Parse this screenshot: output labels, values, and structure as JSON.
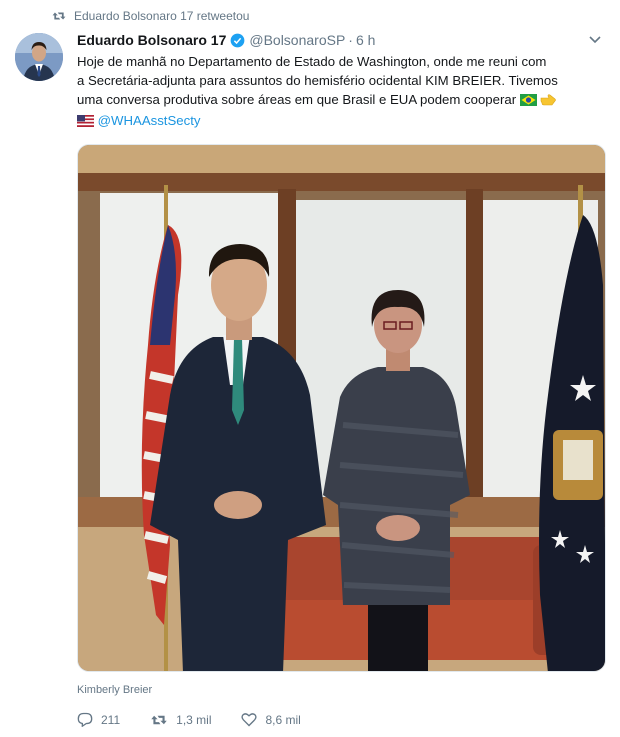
{
  "retweet_context": {
    "text": "Eduardo Bolsonaro 17 retweetou"
  },
  "tweet": {
    "display_name": "Eduardo Bolsonaro 17",
    "handle": "@BolsonaroSP",
    "separator": "·",
    "time": "6 h",
    "lines": [
      "Hoje de manhã no Departamento de Estado de Washington, onde me reuni com",
      "a Secretária-adjunta para assuntos do hemisfério ocidental KIM BREIER. Tivemos",
      "uma conversa produtiva sobre áreas em que Brasil e EUA podem cooperar"
    ],
    "mention": "@WHAAsstSecty",
    "photo_caption": "Kimberly Breier"
  },
  "actions": {
    "replies": "211",
    "retweets": "1,3 mil",
    "likes": "8,6 mil"
  },
  "colors": {
    "link": "#1b95e0",
    "muted": "#657786",
    "text": "#14171a"
  },
  "icons": [
    "retweet-icon",
    "verified-icon",
    "chevron-down-icon",
    "reply-icon",
    "heart-icon",
    "brazil-flag-icon",
    "pointing-hand-icon",
    "us-flag-icon"
  ]
}
